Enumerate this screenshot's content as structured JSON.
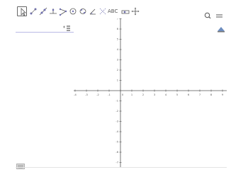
{
  "toolbar": {
    "move_tool": "move-arrow-icon",
    "point_tool": "point-icon",
    "line_tool": "line-icon",
    "perpendicular_tool": "perpendicular-line-icon",
    "polygon_tool": "polygon-icon",
    "circle_tool": "circle-icon",
    "ellipse_tool": "conic-icon",
    "angle_tool": "angle-icon",
    "reflect_tool": "transform-icon",
    "text_tool_label": "ABC",
    "slider_tool": "slider-icon",
    "move_view_tool": "move-graphics-view-icon",
    "search": "search-icon",
    "menu": "hamburger-menu-icon"
  },
  "algebra_view": {
    "sort_icon": "algebra-settings-icon",
    "keyboard_icon": "keyboard-icon"
  },
  "graphics_view": {
    "style_icon": "graphics-style-bar-icon",
    "x_ticks": [
      "-4",
      "-3",
      "-2",
      "-1",
      "0",
      "1",
      "2",
      "3",
      "4",
      "5",
      "6",
      "7",
      "8",
      "9"
    ],
    "y_ticks": [
      "7",
      "6",
      "5",
      "4",
      "3",
      "2",
      "1",
      "-1",
      "-2",
      "-3",
      "-4",
      "-5",
      "-6",
      "-7"
    ]
  },
  "colors": {
    "toolbar_icon": "#6f6fb0",
    "axis": "#555555",
    "selection": "#b9b9e6"
  }
}
